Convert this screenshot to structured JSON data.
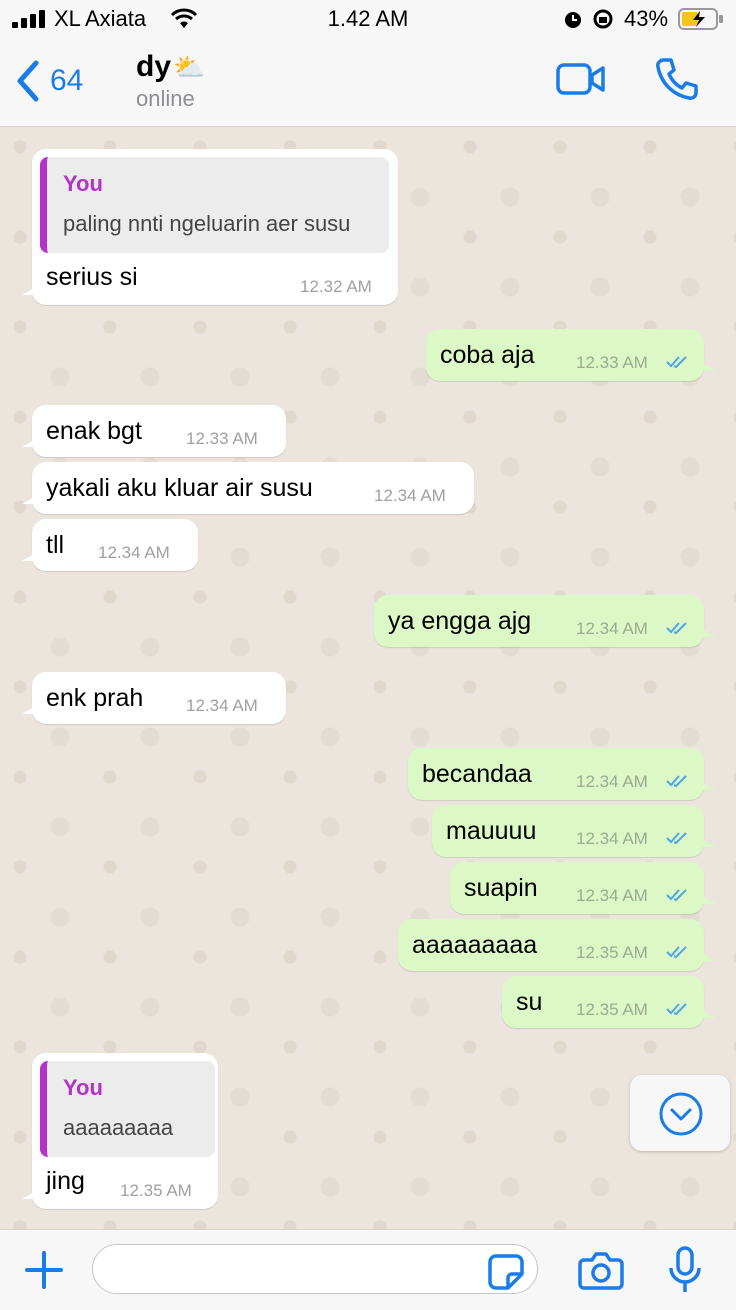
{
  "status_bar": {
    "carrier": "XL Axiata",
    "time": "1.42 AM",
    "battery": "43%"
  },
  "header": {
    "back_count": "64",
    "contact_name": "dy",
    "contact_emoji": "⛅",
    "contact_status": "online"
  },
  "messages": [
    {
      "dir": "in",
      "quote_author": "You",
      "quote_text": "paling nnti ngeluarin aer susu",
      "text": "serius si",
      "time": "12.32 AM"
    },
    {
      "dir": "out",
      "text": "coba aja",
      "time": "12.33 AM"
    },
    {
      "dir": "in",
      "text": "enak bgt",
      "time": "12.33 AM"
    },
    {
      "dir": "in",
      "text": "yakali aku kluar air susu",
      "time": "12.34 AM"
    },
    {
      "dir": "in",
      "text": "tll",
      "time": "12.34 AM"
    },
    {
      "dir": "out",
      "text": "ya engga ajg",
      "time": "12.34 AM"
    },
    {
      "dir": "in",
      "text": "enk prah",
      "time": "12.34 AM"
    },
    {
      "dir": "out",
      "text": "becandaa",
      "time": "12.34 AM"
    },
    {
      "dir": "out",
      "text": "mauuuu",
      "time": "12.34 AM"
    },
    {
      "dir": "out",
      "text": "suapin",
      "time": "12.34 AM"
    },
    {
      "dir": "out",
      "text": "aaaaaaaaa",
      "time": "12.35 AM"
    },
    {
      "dir": "out",
      "text": "su",
      "time": "12.35 AM"
    },
    {
      "dir": "in",
      "quote_author": "You",
      "quote_text": "aaaaaaaaa",
      "text": "jing",
      "time": "12.35 AM"
    }
  ],
  "colors": {
    "accent": "#1a7ce8",
    "incoming": "#ffffff",
    "outgoing": "#dcf8c6",
    "quote_bar": "#b432c8",
    "read_ticks": "#4fa6e8"
  },
  "input": {
    "placeholder": ""
  }
}
